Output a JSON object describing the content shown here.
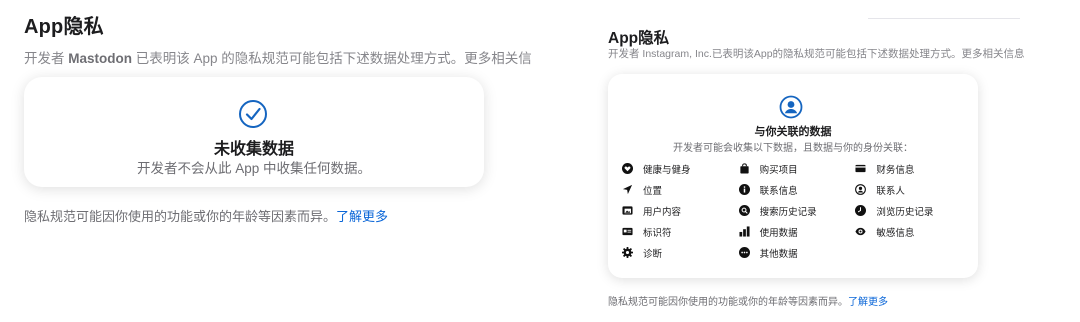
{
  "left": {
    "title": "App隐私",
    "subtitle_prefix": "开发者 ",
    "developer": "Mastodon",
    "subtitle_suffix": " 已表明该 App 的隐私规范可能包括下述数据处理方式。更多相关信息",
    "card_title": "未收集数据",
    "card_desc": "开发者不会从此 App 中收集任何数据。",
    "footer_text": "隐私规范可能因你使用的功能或你的年龄等因素而异。",
    "footer_link": "了解更多"
  },
  "right": {
    "title": "App隐私",
    "subtitle": "开发者 Instagram, Inc.已表明该App的隐私规范可能包括下述数据处理方式。更多相关信息",
    "card_title": "与你关联的数据",
    "card_desc": "开发者可能会收集以下数据，且数据与你的身份关联：",
    "items": [
      [
        "健康与健身",
        "购买项目",
        "财务信息"
      ],
      [
        "位置",
        "联系信息",
        "联系人"
      ],
      [
        "用户内容",
        "搜索历史记录",
        "浏览历史记录"
      ],
      [
        "标识符",
        "使用数据",
        "敏感信息"
      ],
      [
        "诊断",
        "其他数据",
        ""
      ]
    ],
    "icons": [
      [
        "heart-icon",
        "bag-icon",
        "card-icon"
      ],
      [
        "location-arrow-icon",
        "info-icon",
        "contact-icon"
      ],
      [
        "photo-icon",
        "search-icon",
        "clock-icon"
      ],
      [
        "id-card-icon",
        "bar-chart-icon",
        "eye-icon"
      ],
      [
        "gear-icon",
        "ellipsis-icon",
        ""
      ]
    ],
    "footer_text": "隐私规范可能因你使用的功能或你的年龄等因素而异。",
    "footer_link": "了解更多"
  },
  "colors": {
    "link": "#0a66d8",
    "accent": "#1565c0"
  }
}
